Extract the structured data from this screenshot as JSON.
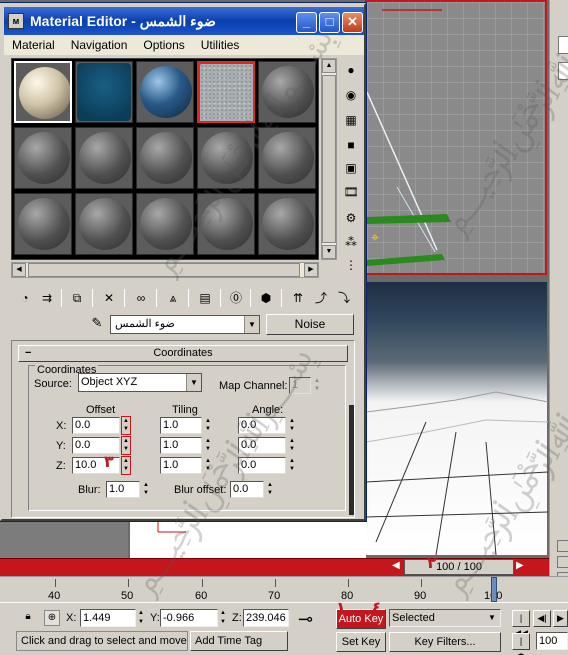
{
  "editor": {
    "title": "Material Editor - ضوء الشمس",
    "title_icon": "3ds-max-icon",
    "caption_buttons": {
      "minimize": "_",
      "maximize": "□",
      "close": "✕"
    },
    "menu": [
      "Material",
      "Navigation",
      "Options",
      "Utilities"
    ],
    "sample_slots": 15,
    "active_slot": 0,
    "selected_slot": 3,
    "material_name": "ضوء الشمس",
    "type_button": "Noise",
    "side_tools": [
      "sample-type-sphere-icon",
      "backlight-icon",
      "background-checker-icon",
      "sample-uv-tiling-icon",
      "video-color-check-icon",
      "make-preview-icon",
      "options-icon",
      "select-by-material-icon",
      "material-map-navigator-icon"
    ],
    "bottom_tools": [
      "get-material-icon",
      "put-to-scene-icon",
      "assign-to-selection-icon",
      "reset-map-icon",
      "make-copy-icon",
      "make-unique-icon",
      "put-to-library-icon",
      "material-effects-channel-icon",
      "show-map-in-viewport-icon",
      "show-end-result-icon",
      "go-to-parent-icon",
      "go-forward-to-sibling-icon"
    ],
    "rollout": {
      "title": "Coordinates",
      "collapse_symbol": "−",
      "group_label": "Coordinates",
      "source_label": "Source:",
      "source_value": "Object XYZ",
      "map_channel_label": "Map Channel:",
      "map_channel_value": "1",
      "headers": {
        "offset": "Offset",
        "tiling": "Tiling",
        "angle": "Angle:"
      },
      "rows": [
        {
          "axis": "X:",
          "offset": "0.0",
          "tiling": "1.0",
          "angle": "0.0"
        },
        {
          "axis": "Y:",
          "offset": "0.0",
          "tiling": "1.0",
          "angle": "0.0"
        },
        {
          "axis": "Z:",
          "offset": "10.0",
          "tiling": "1.0",
          "angle": "0.0"
        }
      ],
      "blur_label": "Blur:",
      "blur_value": "1.0",
      "blur_offset_label": "Blur offset:",
      "blur_offset_value": "0.0"
    }
  },
  "timeline": {
    "slider_text": "100 / 100",
    "ticks": [
      "40",
      "50",
      "60",
      "70",
      "80",
      "90",
      "100"
    ]
  },
  "status": {
    "x_label": "X:",
    "x_value": "1.449",
    "y_label": "Y:",
    "y_value": "-0.966",
    "z_label": "Z:",
    "z_value": "239.046",
    "auto_key": "Auto Key",
    "selected": "Selected",
    "set_key": "Set Key",
    "key_filters": "Key Filters...",
    "frame": "100",
    "prompt": "Click and drag to select and move",
    "add_time_tag": "Add Time Tag"
  },
  "annotations": [
    "١",
    "٢",
    "٣",
    "٤"
  ],
  "colors": {
    "accent_red": "#c4161c",
    "title_blue": "#0a3fae",
    "panel_gray": "#d4d0c8"
  }
}
